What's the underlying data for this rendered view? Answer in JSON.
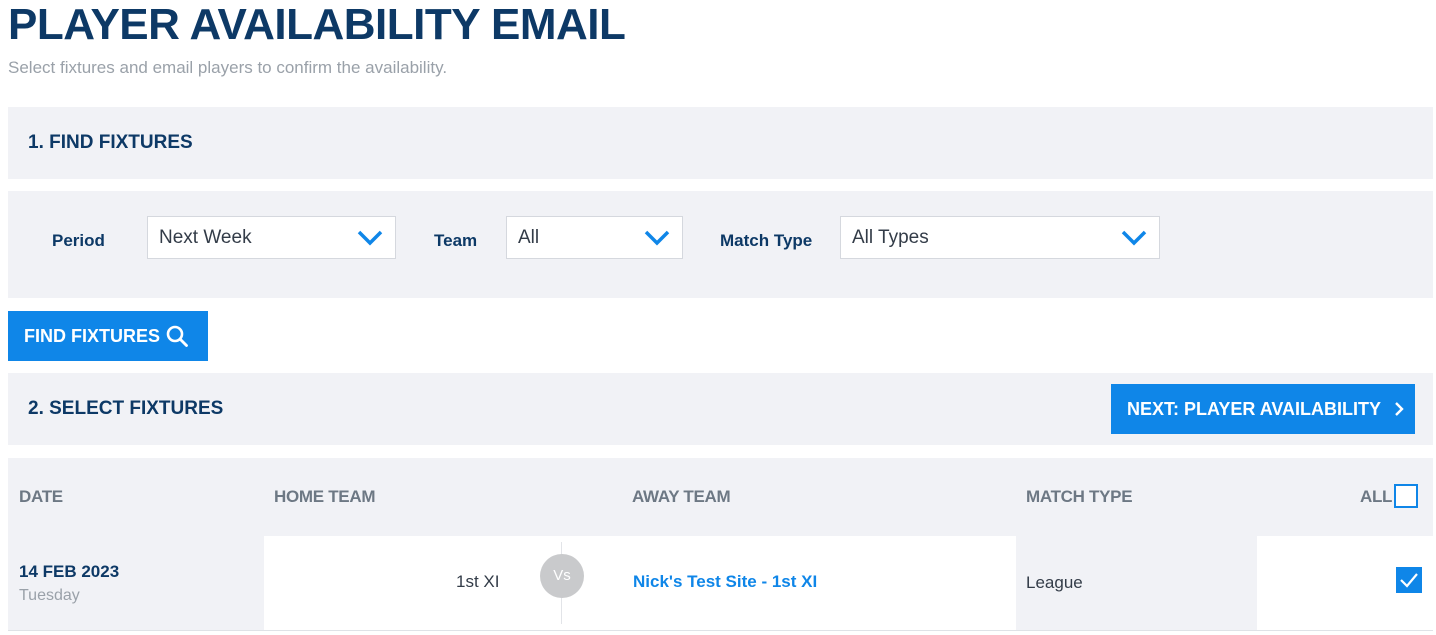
{
  "page": {
    "title": "PLAYER AVAILABILITY EMAIL",
    "subtitle": "Select fixtures and email players to confirm the availability."
  },
  "find_section": {
    "title": "1. FIND FIXTURES",
    "filters": {
      "period": {
        "label": "Period",
        "value": "Next Week"
      },
      "team": {
        "label": "Team",
        "value": "All"
      },
      "match_type": {
        "label": "Match Type",
        "value": "All Types"
      }
    },
    "find_button": {
      "label": "FIND FIXTURES",
      "icon": "search-icon"
    }
  },
  "select_section": {
    "title": "2. SELECT FIXTURES",
    "next_button": {
      "label": "NEXT: PLAYER AVAILABILITY",
      "icon": "chevron-right-icon"
    }
  },
  "table": {
    "columns": [
      "DATE",
      "HOME TEAM",
      "AWAY TEAM",
      "MATCH TYPE",
      "ALL"
    ],
    "select_all_checked": false,
    "rows": [
      {
        "date": "14 FEB 2023",
        "day": "Tuesday",
        "home_team": "1st XI",
        "vs": "Vs",
        "away_team": "Nick's Test Site - 1st XI",
        "match_type": "League",
        "checked": true
      }
    ]
  },
  "colors": {
    "primary": "#0f86e8",
    "navy": "#0d3966",
    "panel": "#f1f2f6"
  }
}
